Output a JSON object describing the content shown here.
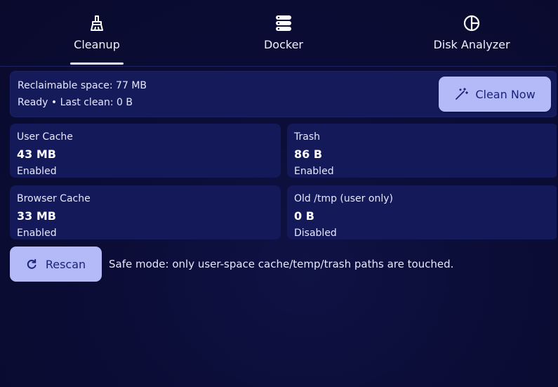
{
  "tabs": [
    {
      "label": "Cleanup",
      "icon": "broom-icon",
      "active": true
    },
    {
      "label": "Docker",
      "icon": "server-stack-icon",
      "active": false
    },
    {
      "label": "Disk Analyzer",
      "icon": "pie-chart-icon",
      "active": false
    }
  ],
  "summary": {
    "reclaimable": "Reclaimable space: 77 MB",
    "status": "Ready • Last clean: 0 B"
  },
  "clean_button": {
    "label": "Clean Now",
    "icon": "magic-wand-icon"
  },
  "cards": [
    {
      "title": "User Cache",
      "value": "43 MB",
      "status": "Enabled"
    },
    {
      "title": "Trash",
      "value": "86 B",
      "status": "Enabled"
    },
    {
      "title": "Browser Cache",
      "value": "33 MB",
      "status": "Enabled"
    },
    {
      "title": "Old /tmp (user only)",
      "value": "0 B",
      "status": "Disabled"
    }
  ],
  "rescan_button": {
    "label": "Rescan",
    "icon": "refresh-icon"
  },
  "safe_note": "Safe mode: only user-space cache/temp/trash paths are touched.",
  "colors": {
    "background": "#0a0b2e",
    "card": "#141959",
    "button": "#b4baf8",
    "button_text": "#1c237a"
  }
}
